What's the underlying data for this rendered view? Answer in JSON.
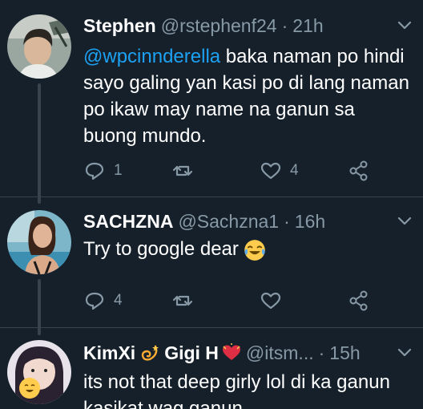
{
  "tweets": [
    {
      "name": "Stephen",
      "handle": "@rstephenf24",
      "separator": "·",
      "time": "21h",
      "mention": "@wpcinnderella",
      "text": " baka naman po hindi sayo galing yan kasi po di lang naman po ikaw may name na ganun sa buong mundo.",
      "replies": "1",
      "retweets": "",
      "likes": "4"
    },
    {
      "name": "SACHZNA",
      "handle": "@Sachzna1",
      "separator": "·",
      "time": "16h",
      "text": "Try to google dear",
      "replies": "4",
      "retweets": "",
      "likes": ""
    },
    {
      "name": "KimXi",
      "name2": "Gigi H",
      "handle": "@itsm...",
      "separator": "·",
      "time": "15h",
      "text": "its not that deep girly lol di ka ganun kasikat wag ganun"
    }
  ],
  "colors": {
    "background": "#15202b",
    "mention": "#1da1f2",
    "muted": "#8899a6",
    "divider": "#38444d"
  },
  "icons": [
    "reply-icon",
    "retweet-icon",
    "like-icon",
    "share-icon",
    "chevron-down-icon",
    "dizzy-emoji",
    "heart-emoji",
    "crying-laughing-emoji"
  ]
}
